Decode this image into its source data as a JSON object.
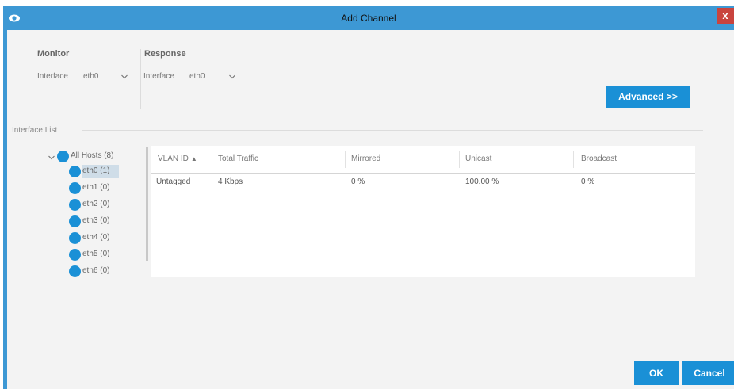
{
  "window": {
    "title": "Add Channel",
    "close_label": "x"
  },
  "monitor": {
    "heading": "Monitor",
    "interface_label": "Interface",
    "interface_value": "eth0"
  },
  "response": {
    "heading": "Response",
    "interface_label": "Interface",
    "interface_value": "eth0"
  },
  "advanced_button": "Advanced >>",
  "interface_list": {
    "label": "Interface List",
    "root": "All Hosts (8)",
    "items": [
      "eth0 (1)",
      "eth1 (0)",
      "eth2 (0)",
      "eth3 (0)",
      "eth4 (0)",
      "eth5 (0)",
      "eth6 (0)"
    ],
    "selected": "eth0 (1)"
  },
  "table": {
    "columns": [
      "VLAN ID",
      "Total Traffic",
      "Mirrored",
      "Unicast",
      "Broadcast"
    ],
    "sort_indicator": "▲",
    "rows": [
      [
        "Untagged",
        "4 Kbps",
        "0 %",
        "100.00 %",
        "0 %"
      ]
    ]
  },
  "footer": {
    "ok_label": "OK",
    "cancel_label": "Cancel"
  },
  "colors": {
    "accent": "#1a90d6",
    "titlebar": "#3d98d4",
    "close": "#c9443e"
  }
}
